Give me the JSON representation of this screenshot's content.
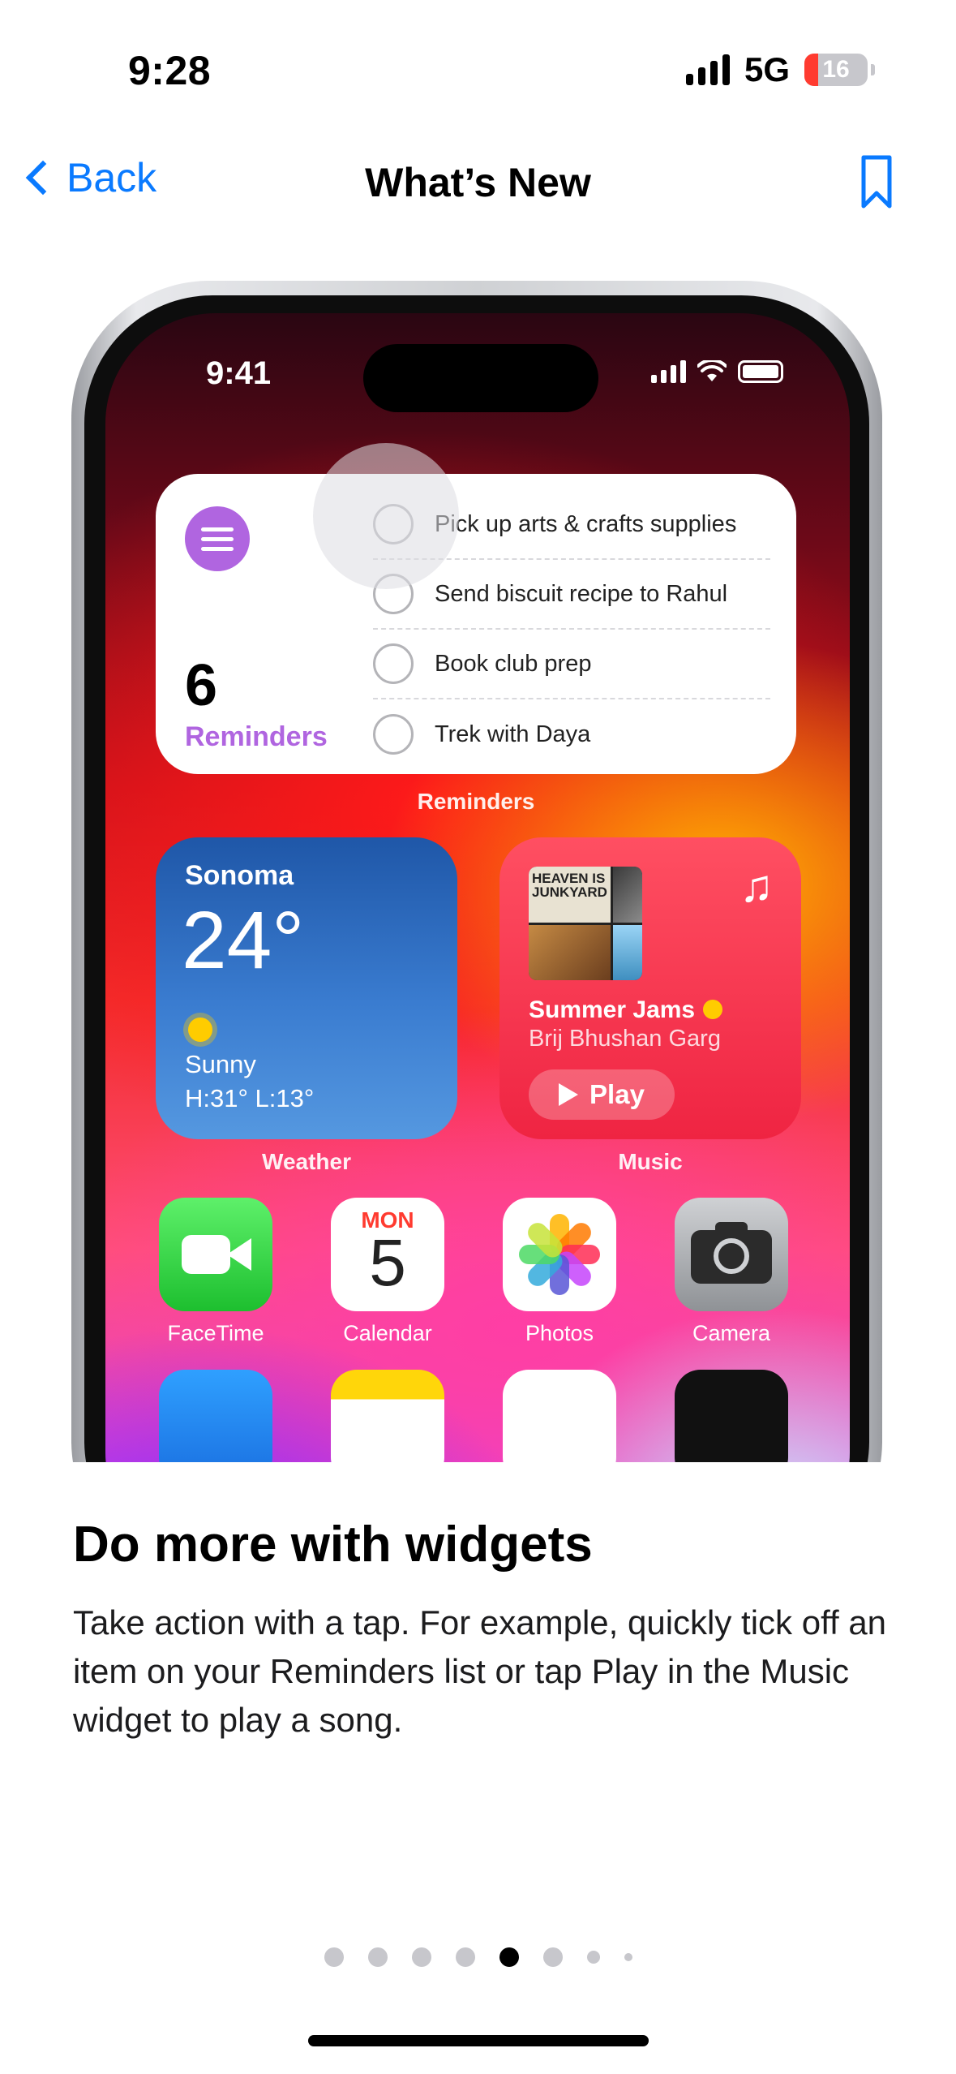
{
  "status_bar": {
    "time": "9:28",
    "network": "5G",
    "battery": "16"
  },
  "nav": {
    "back_label": "Back",
    "title": "What’s New"
  },
  "hero": {
    "phone_time": "9:41",
    "reminders_widget": {
      "count": "6",
      "label": "Reminders",
      "items": [
        "Pick up arts & crafts supplies",
        "Send biscuit recipe to Rahul",
        "Book club prep",
        "Trek with Daya"
      ],
      "caption": "Reminders"
    },
    "weather_widget": {
      "city": "Sonoma",
      "temperature": "24°",
      "condition": "Sunny",
      "high_low": "H:31° L:13°",
      "caption": "Weather"
    },
    "music_widget": {
      "album_text": "HEAVEN IS JUNKYARD",
      "title": "Summer Jams",
      "artist": "Brij Bhushan Garg",
      "play_label": "Play",
      "caption": "Music"
    },
    "apps": [
      {
        "name": "FaceTime",
        "icon": "facetime-icon"
      },
      {
        "name": "Calendar",
        "icon": "calendar-icon",
        "weekday": "MON",
        "day": "5"
      },
      {
        "name": "Photos",
        "icon": "photos-icon"
      },
      {
        "name": "Camera",
        "icon": "camera-icon"
      }
    ]
  },
  "content": {
    "headline": "Do more with widgets",
    "body": "Take action with a tap. For example, quickly tick off an item on your Reminders list or tap Play in the Music widget to play a song."
  },
  "pagination": {
    "total": 8,
    "current": 5
  },
  "colors": {
    "accent": "#0a7aff",
    "reminders_purple": "#b065e0",
    "music_red": "#ef2442",
    "weather_blue": "#2f6fc4"
  }
}
